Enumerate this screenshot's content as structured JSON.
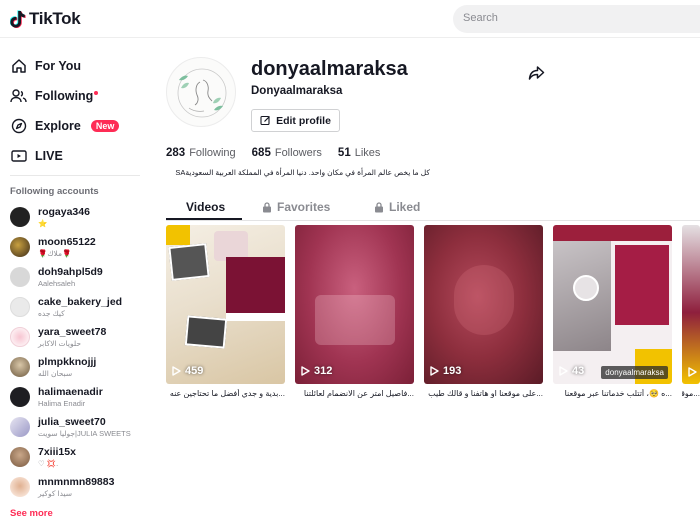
{
  "header": {
    "logo_text": "TikTok",
    "search_placeholder": "Search"
  },
  "sidebar": {
    "nav": [
      {
        "label": "For You",
        "icon": "home-icon"
      },
      {
        "label": "Following",
        "icon": "following-icon"
      },
      {
        "label": "Explore",
        "icon": "compass-icon",
        "badge": "New"
      },
      {
        "label": "LIVE",
        "icon": "live-icon"
      }
    ],
    "following_title": "Following accounts",
    "accounts": [
      {
        "name": "rogaya346",
        "sub": "⭐"
      },
      {
        "name": "moon65122",
        "sub": "🌹ملاك🌹"
      },
      {
        "name": "doh9ahpl5d9",
        "sub": "Aalehsaleh"
      },
      {
        "name": "cake_bakery_jed",
        "sub": "كيك جده"
      },
      {
        "name": "yara_sweet78",
        "sub": "حلويات الاكابر"
      },
      {
        "name": "plmpkknojjj",
        "sub": "سبحان الله"
      },
      {
        "name": "halimaenadir",
        "sub": "Halima Enadir"
      },
      {
        "name": "julia_sweet70",
        "sub": "جوليا سويت|JULIA SWEETS"
      },
      {
        "name": "7xiii15x",
        "sub": "♡ 💢."
      },
      {
        "name": "mnmnmn89883",
        "sub": "سيدا كوكير"
      }
    ],
    "see_more": "See more"
  },
  "profile": {
    "username": "donyaalmaraksa",
    "nickname": "Donyaalmaraksa",
    "edit_label": "Edit profile",
    "following_count": "283",
    "following_label": "Following",
    "followers_count": "685",
    "followers_label": "Followers",
    "likes_count": "51",
    "likes_label": "Likes",
    "bio": "كل ما يخص عالم المرأة في مكان واحد. دنيا المرأة في المملكة العربية السعوديةSA"
  },
  "tabs": [
    {
      "label": "Videos",
      "active": true
    },
    {
      "label": "Favorites",
      "icon": "lock-icon"
    },
    {
      "label": "Liked",
      "icon": "lock-icon"
    }
  ],
  "videos": [
    {
      "views": "459",
      "caption": "...بدية و جدي أفضل ما تحتاجين عنه",
      "tag": ""
    },
    {
      "views": "312",
      "caption": "...فاصيل امتر عن الانضمام لعائلتنا",
      "tag": ""
    },
    {
      "views": "193",
      "caption": "...على موقعنا او هاتفنا و قالك طيب",
      "tag": ""
    },
    {
      "views": "43",
      "caption": "...ه 🥺، أتتلب خدماتنا عبر موقعنا",
      "tag": "donyaalmaraksa"
    },
    {
      "views": "",
      "caption": "...موقعنا",
      "tag": ""
    }
  ]
}
